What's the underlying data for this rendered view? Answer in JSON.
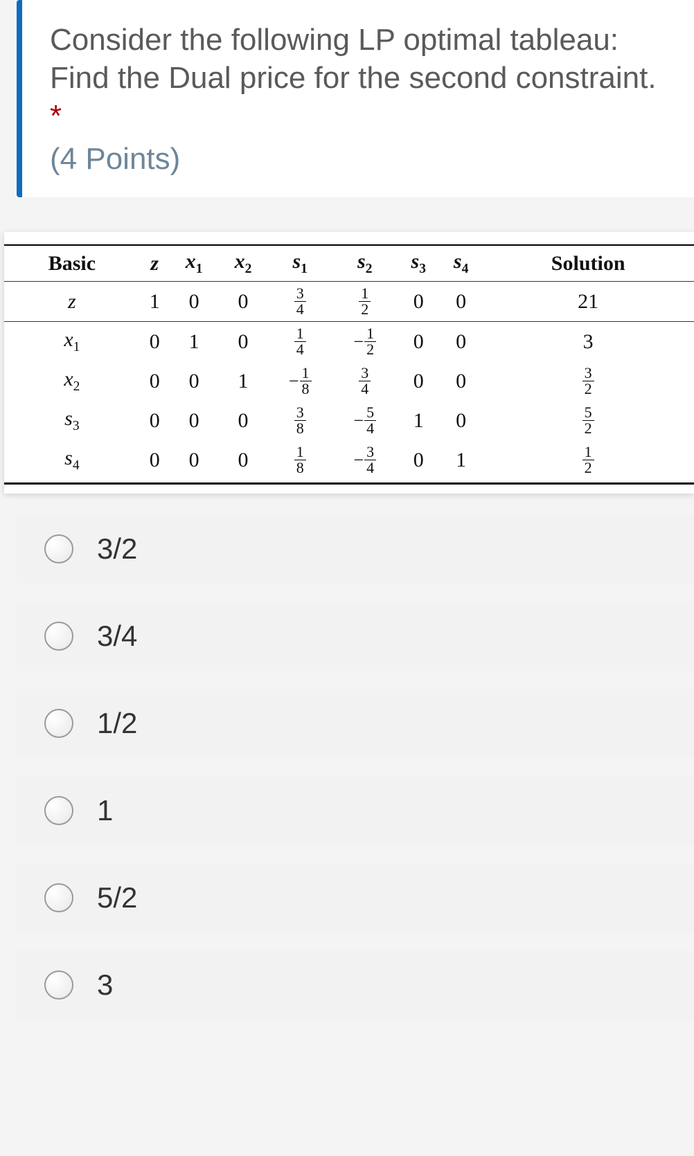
{
  "question": {
    "text": "Consider the following LP optimal tableau: Find the Dual price for the second constraint.",
    "required_marker": "*",
    "points_label": "(4 Points)"
  },
  "chart_data": {
    "type": "table",
    "title": "LP optimal tableau",
    "columns": [
      "Basic",
      "z",
      "x1",
      "x2",
      "s1",
      "s2",
      "s3",
      "s4",
      "Solution"
    ],
    "rows": [
      {
        "basic": "z",
        "z": "1",
        "x1": "0",
        "x2": "0",
        "s1": "3/4",
        "s2": "1/2",
        "s3": "0",
        "s4": "0",
        "solution": "21"
      },
      {
        "basic": "x1",
        "z": "0",
        "x1": "1",
        "x2": "0",
        "s1": "1/4",
        "s2": "-1/2",
        "s3": "0",
        "s4": "0",
        "solution": "3"
      },
      {
        "basic": "x2",
        "z": "0",
        "x1": "0",
        "x2": "1",
        "s1": "-1/8",
        "s2": "3/4",
        "s3": "0",
        "s4": "0",
        "solution": "3/2"
      },
      {
        "basic": "s3",
        "z": "0",
        "x1": "0",
        "x2": "0",
        "s1": "3/8",
        "s2": "-5/4",
        "s3": "1",
        "s4": "0",
        "solution": "5/2"
      },
      {
        "basic": "s4",
        "z": "0",
        "x1": "0",
        "x2": "0",
        "s1": "1/8",
        "s2": "-3/4",
        "s3": "0",
        "s4": "1",
        "solution": "1/2"
      }
    ]
  },
  "options": [
    {
      "label": "3/2"
    },
    {
      "label": "3/4"
    },
    {
      "label": "1/2"
    },
    {
      "label": "1"
    },
    {
      "label": "5/2"
    },
    {
      "label": "3"
    }
  ]
}
